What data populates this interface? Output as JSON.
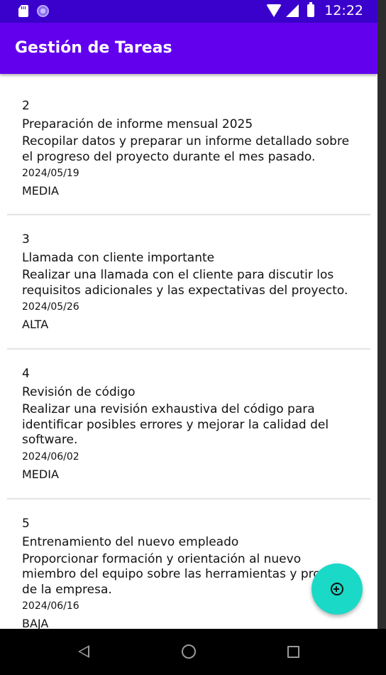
{
  "status_bar": {
    "time": "12:22",
    "icons": [
      "sd-card-icon",
      "circle-app-icon",
      "wifi-icon",
      "signal-icon",
      "battery-icon"
    ]
  },
  "app_bar": {
    "title": "Gestión de Tareas"
  },
  "colors": {
    "status_bar": "#3a00cc",
    "app_bar": "#6200ee",
    "fab": "#1ad9c6",
    "nav_bar": "#000000"
  },
  "tasks": [
    {
      "id": "2",
      "title": "Preparación de informe mensual 2025",
      "description": "Recopilar datos y preparar un informe detallado sobre el progreso del proyecto durante el mes pasado.",
      "date": "2024/05/19",
      "priority": "MEDIA"
    },
    {
      "id": "3",
      "title": "Llamada con cliente importante",
      "description": "Realizar una llamada con el cliente para discutir los requisitos adicionales y las expectativas del proyecto.",
      "date": "2024/05/26",
      "priority": "ALTA"
    },
    {
      "id": "4",
      "title": "Revisión de código",
      "description": "Realizar una revisión exhaustiva del código para identificar posibles errores y mejorar la calidad del software.",
      "date": "2024/06/02",
      "priority": "MEDIA"
    },
    {
      "id": "5",
      "title": "Entrenamiento del nuevo empleado",
      "description": "Proporcionar formación y orientación al nuevo miembro del equipo sobre las herramientas y procesos de la empresa.",
      "date": "2024/06/16",
      "priority": "BAJA"
    }
  ],
  "fab": {
    "icon": "add-circle-icon"
  },
  "nav_bar": {
    "icons": [
      "back-icon",
      "home-icon",
      "recent-apps-icon"
    ]
  }
}
